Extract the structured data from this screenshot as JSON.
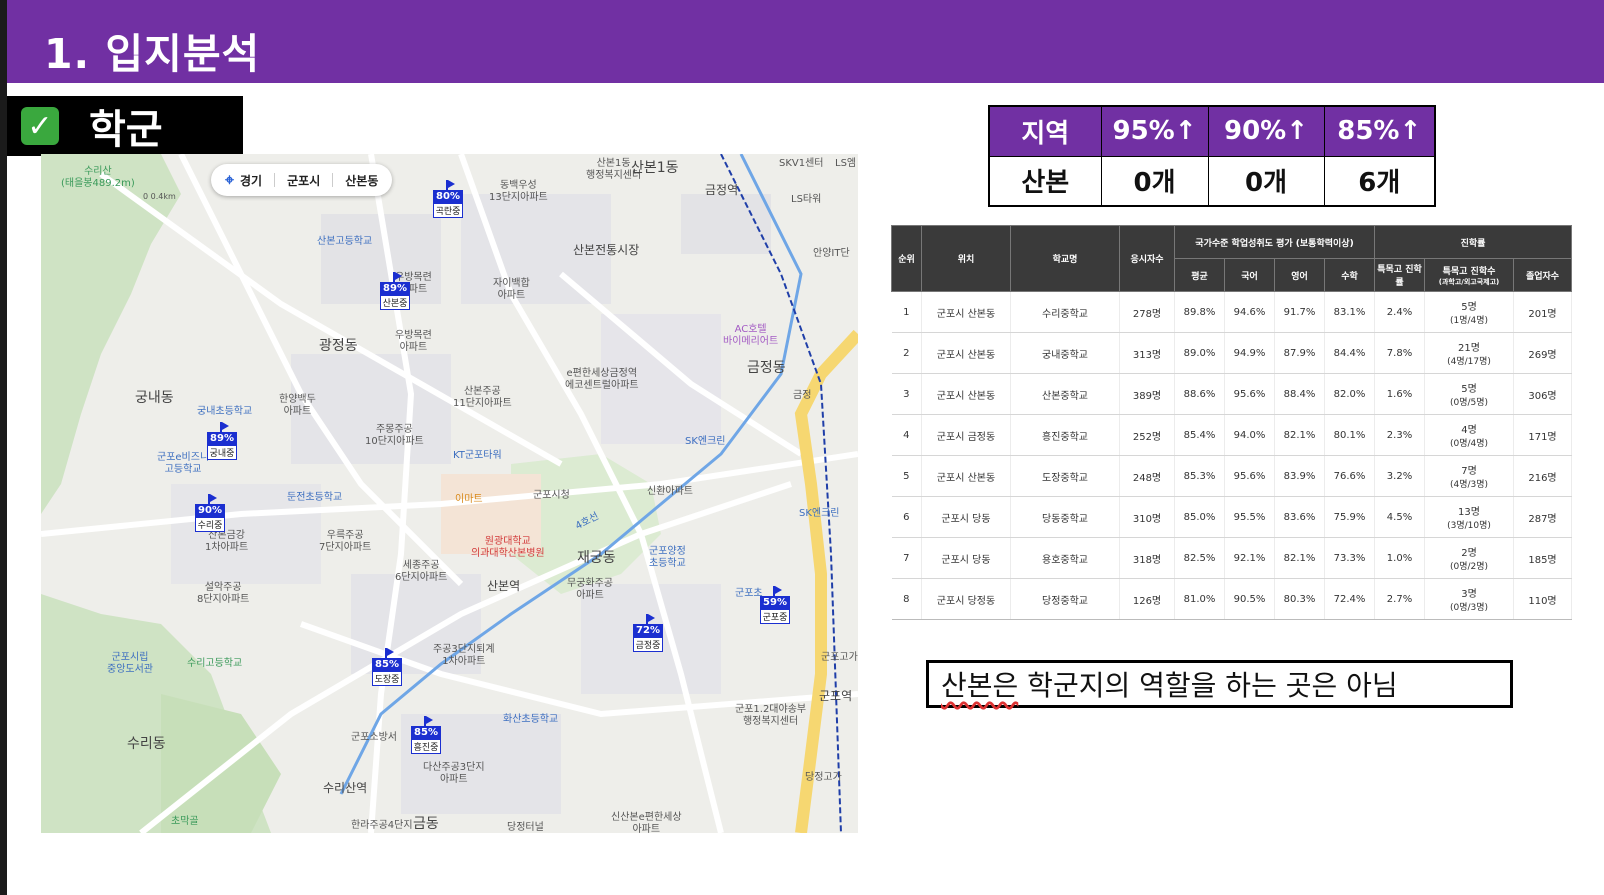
{
  "header": {
    "title": "1. 입지분석"
  },
  "section": {
    "check_icon": "check-mark-icon",
    "label": "학군"
  },
  "map": {
    "chip": {
      "items": [
        "경기",
        "군포시",
        "산본동"
      ]
    },
    "labels": {
      "suri_mt": "수리산\n(태을봉489.2m)",
      "sanbon1": "산본1동\n행정복지센터",
      "sanbon1_big": "산본1동",
      "dongbaek": "동백우성\n13단지아파트",
      "geumjeong_st": "금정역",
      "skv1": "SKV1센터",
      "ls": "LS엠",
      "ls_tower": "LS타워",
      "sanbon_high": "산본고등학교",
      "sanbon_market": "산본전통시장",
      "anyang_it": "안양IT단",
      "woobang1": "우방목련\n아파트",
      "jai": "자이백합\n아파트",
      "woobang2": "우방목련\n아파트",
      "ac_hotel": "AC호텔\n바이메리어트",
      "gwangjeong": "광정동",
      "ecent": "e편한세상금정역\n에코센트럴아파트",
      "geumjeong_dong": "금정동",
      "gungnae": "궁내동",
      "hanyang": "한양백두\n아파트",
      "sanbon11": "산본주공\n11단지아파트",
      "gungnae_elem": "궁내초등학교",
      "jumong10": "주몽주공\n10단지아파트",
      "kt": "KT군포타워",
      "sk_en1": "SK엔크린",
      "ebiz": "군포e비즈니\n고등학교",
      "geumjeong_ic": "금정",
      "dunjeon": "둔전초등학교",
      "emart": "이마트",
      "gunpo_city": "군포시청",
      "sinhwan": "신환아파트",
      "sk_en2": "SK엔크린",
      "woogeuk7": "우륵주공\n7단지아파트",
      "geumgang": "산본금강\n1차아파트",
      "wonkwang": "원광대학교\n의과대학산본병원",
      "sejong6": "세종주공\n6단지아파트",
      "jaegung": "재궁동",
      "gunpo_yj": "군포양정\n초등학교",
      "seolak8": "설악주공\n8단지아파트",
      "sanbon_st": "산본역",
      "mugung": "무궁화주공\n아파트",
      "gunpo_elem": "군포초",
      "gunpo_lib": "군포시립\n중앙도서관",
      "suri_high": "수리고등학교",
      "jugong1": "주공3단지퇴계\n1차아파트",
      "gunpo_st": "군포역",
      "gunpo_gy": "군포고가",
      "hwasan": "화산초등학교",
      "gunpo12": "군포1.2대야송부\n행정복지센터",
      "fire": "군포소방서",
      "dasan": "다산주공3단지\n아파트",
      "suri_dong": "수리동",
      "surisan_st": "수리산역",
      "dangjeong_gy": "당정고가",
      "hanra": "한라주공4단지",
      "geum_dong2": "금동",
      "chomakgol": "초막골",
      "sanbon_ecent": "신산본e편한세상\n아파트",
      "dangdang": "당정터널",
      "line4": "4호선",
      "distance": "0 0.4km"
    },
    "flags": [
      {
        "pct": "80%",
        "name": "곡란중"
      },
      {
        "pct": "89%",
        "name": "산본중"
      },
      {
        "pct": "89%",
        "name": "궁내중"
      },
      {
        "pct": "90%",
        "name": "수리중"
      },
      {
        "pct": "85%",
        "name": "도장중"
      },
      {
        "pct": "85%",
        "name": "흥진중"
      },
      {
        "pct": "72%",
        "name": "금정중"
      },
      {
        "pct": "59%",
        "name": "군포중"
      }
    ]
  },
  "summary": {
    "headers": [
      "지역",
      "95%↑",
      "90%↑",
      "85%↑"
    ],
    "row": [
      "산본",
      "0개",
      "0개",
      "6개"
    ]
  },
  "schools": {
    "headers": {
      "rank": "순위",
      "location": "위치",
      "name": "학교명",
      "takers": "응시자수",
      "group_eval": "국가수준 학업성취도 평가 (보통학력이상)",
      "avg": "평균",
      "kor": "국어",
      "eng": "영어",
      "math": "수학",
      "group_adv": "진학률",
      "special_rate": "특목고 진학률",
      "special_count": "특목고 진학수",
      "special_sub": "(과학고/외고국제고)",
      "grads": "졸업자수"
    },
    "rows": [
      {
        "rank": "1",
        "location": "군포시 산본동",
        "name": "수리중학교",
        "takers": "278명",
        "avg": "89.8%",
        "kor": "94.6%",
        "eng": "91.7%",
        "math": "83.1%",
        "rate": "2.4%",
        "count": "5명",
        "count_sub": "(1명/4명)",
        "grads": "201명"
      },
      {
        "rank": "2",
        "location": "군포시 산본동",
        "name": "궁내중학교",
        "takers": "313명",
        "avg": "89.0%",
        "kor": "94.9%",
        "eng": "87.9%",
        "math": "84.4%",
        "rate": "7.8%",
        "count": "21명",
        "count_sub": "(4명/17명)",
        "grads": "269명"
      },
      {
        "rank": "3",
        "location": "군포시 산본동",
        "name": "산본중학교",
        "takers": "389명",
        "avg": "88.6%",
        "kor": "95.6%",
        "eng": "88.4%",
        "math": "82.0%",
        "rate": "1.6%",
        "count": "5명",
        "count_sub": "(0명/5명)",
        "grads": "306명"
      },
      {
        "rank": "4",
        "location": "군포시 금정동",
        "name": "흥진중학교",
        "takers": "252명",
        "avg": "85.4%",
        "kor": "94.0%",
        "eng": "82.1%",
        "math": "80.1%",
        "rate": "2.3%",
        "count": "4명",
        "count_sub": "(0명/4명)",
        "grads": "171명"
      },
      {
        "rank": "5",
        "location": "군포시 산본동",
        "name": "도장중학교",
        "takers": "248명",
        "avg": "85.3%",
        "kor": "95.6%",
        "eng": "83.9%",
        "math": "76.6%",
        "rate": "3.2%",
        "count": "7명",
        "count_sub": "(4명/3명)",
        "grads": "216명"
      },
      {
        "rank": "6",
        "location": "군포시 당동",
        "name": "당동중학교",
        "takers": "310명",
        "avg": "85.0%",
        "kor": "95.5%",
        "eng": "83.6%",
        "math": "75.9%",
        "rate": "4.5%",
        "count": "13명",
        "count_sub": "(3명/10명)",
        "grads": "287명"
      },
      {
        "rank": "7",
        "location": "군포시 당동",
        "name": "용호중학교",
        "takers": "318명",
        "avg": "82.5%",
        "kor": "92.1%",
        "eng": "82.1%",
        "math": "73.3%",
        "rate": "1.0%",
        "count": "2명",
        "count_sub": "(0명/2명)",
        "grads": "185명"
      },
      {
        "rank": "8",
        "location": "군포시 당정동",
        "name": "당정중학교",
        "takers": "126명",
        "avg": "81.0%",
        "kor": "90.5%",
        "eng": "80.3%",
        "math": "72.4%",
        "rate": "2.7%",
        "count": "3명",
        "count_sub": "(0명/3명)",
        "grads": "110명"
      }
    ]
  },
  "note": {
    "underlined": "산본은",
    "rest": " 학군지의 역할을 하는 곳은 아님"
  }
}
